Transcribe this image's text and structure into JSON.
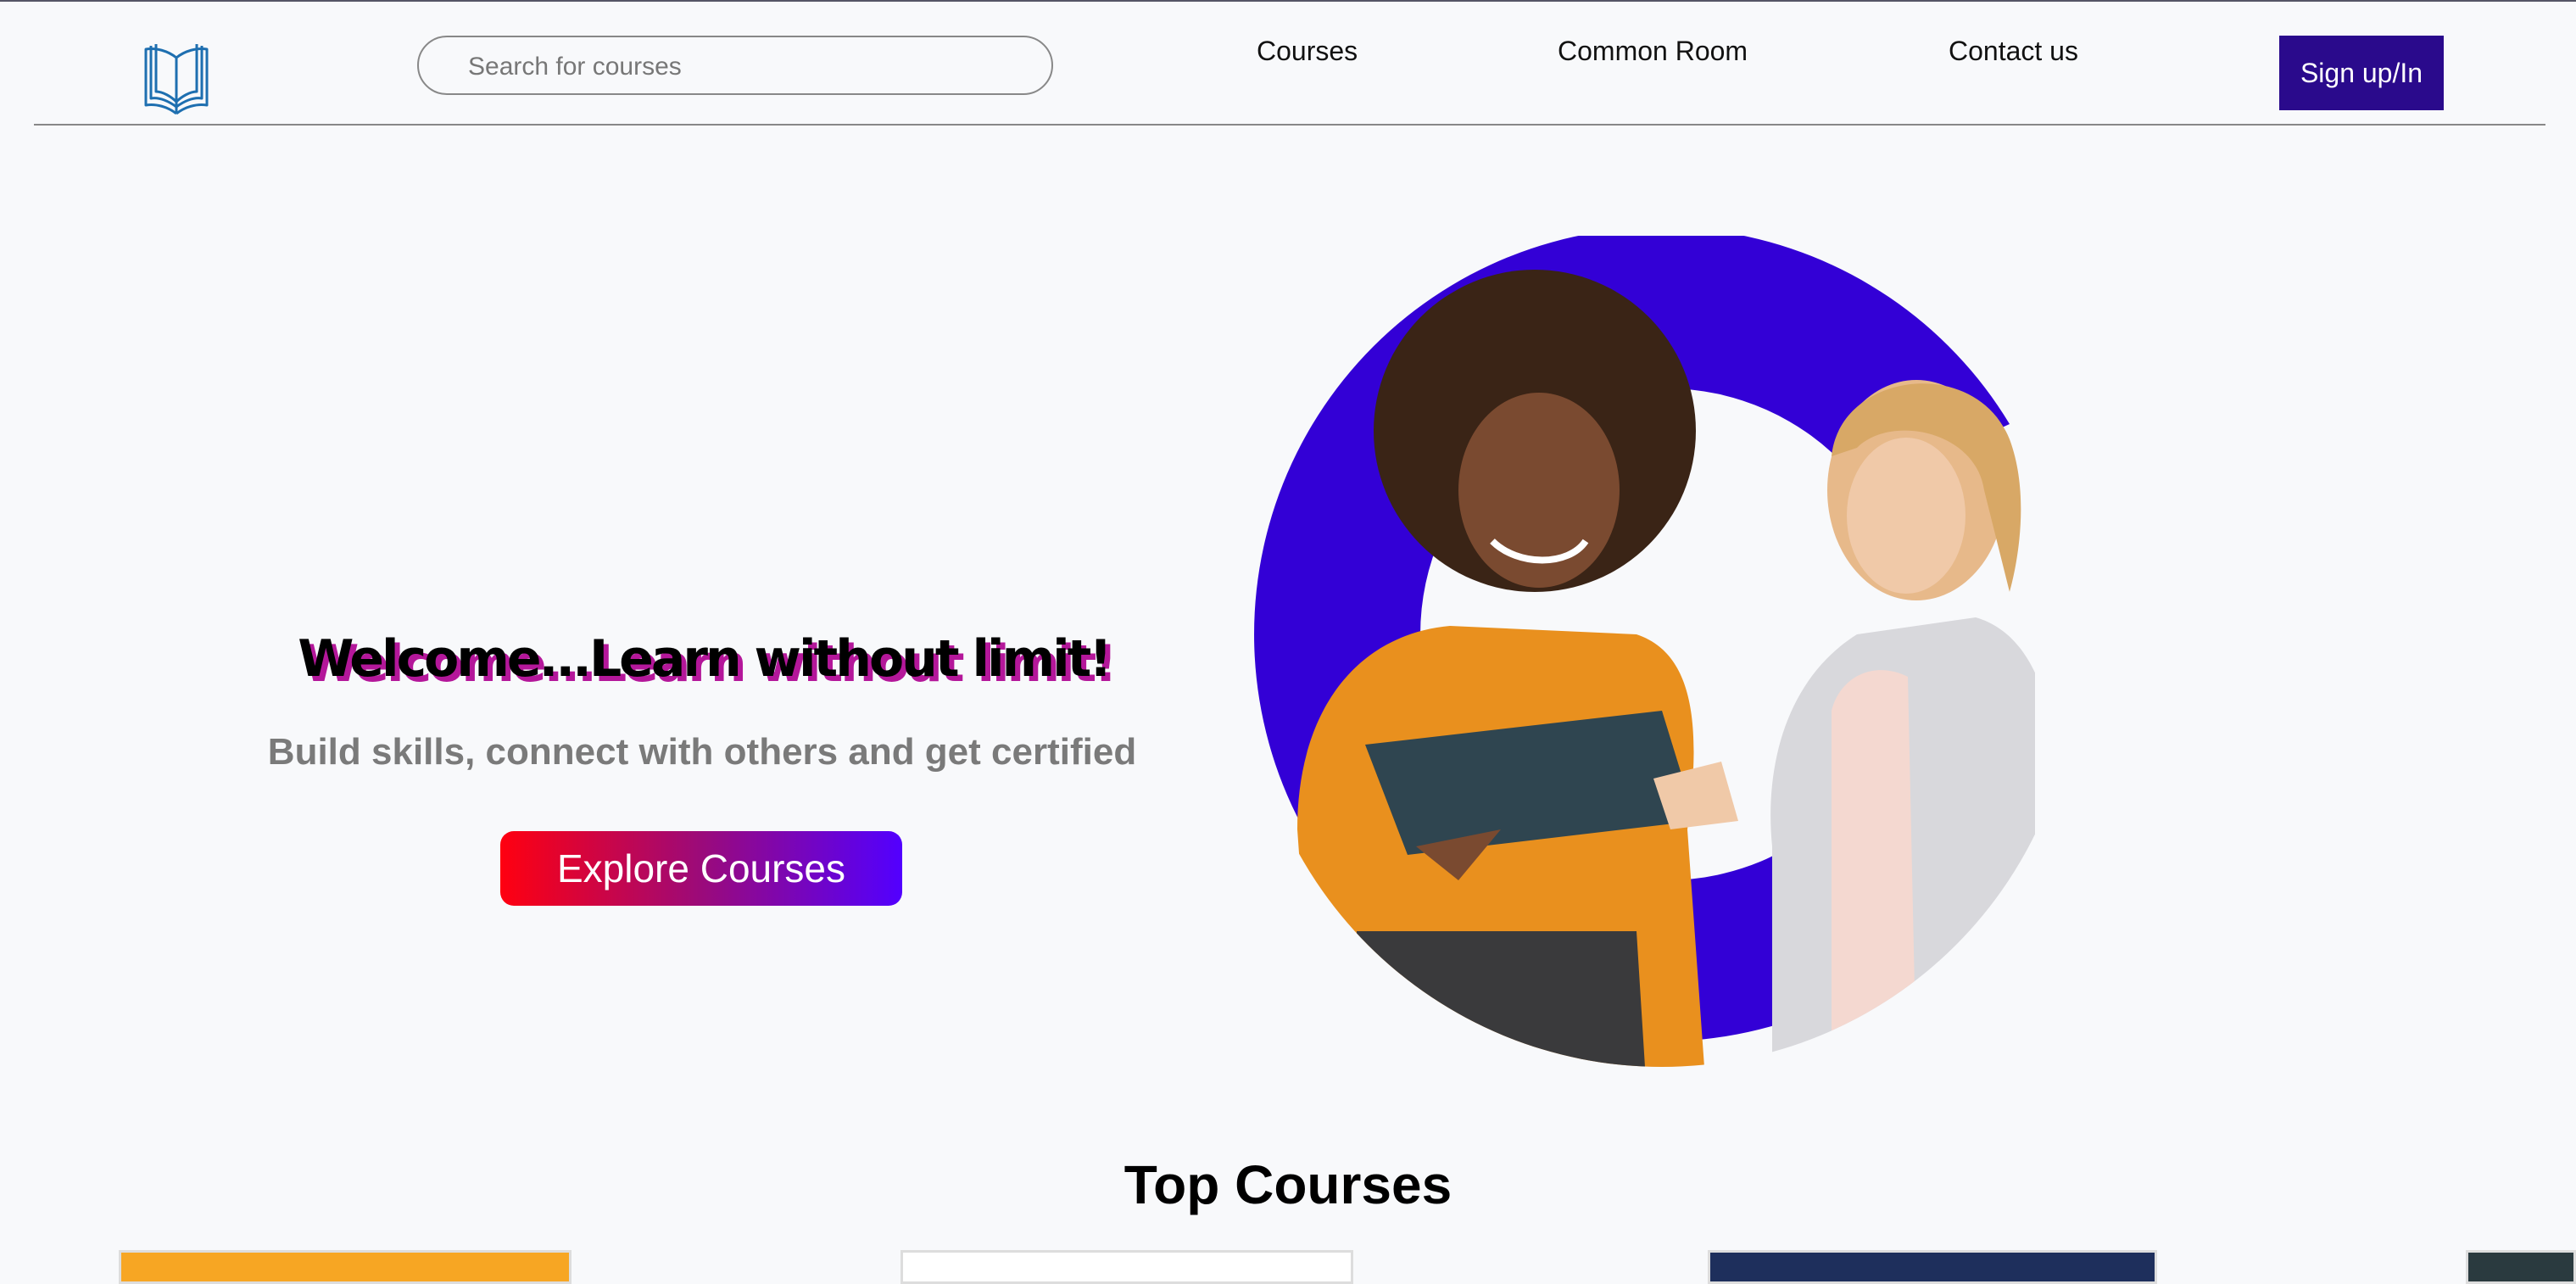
{
  "search": {
    "placeholder": "Search for courses"
  },
  "nav": {
    "links": [
      "Courses",
      "Common Room",
      "Contact us"
    ],
    "signup_label": "Sign up/In"
  },
  "hero": {
    "title": "Welcome...Learn without limit!",
    "subtitle": "Build skills, connect with others and get certified",
    "cta_label": "Explore Courses"
  },
  "top_courses": {
    "title": "Top Courses"
  },
  "colors": {
    "accent": "#2a0a8c",
    "circle_blue": "#3300d6",
    "cta_gradient_start": "#ff0010",
    "cta_gradient_end": "#5200ff",
    "title_shadow": "#b4179a"
  },
  "icons": {
    "logo": "open-book-icon"
  }
}
